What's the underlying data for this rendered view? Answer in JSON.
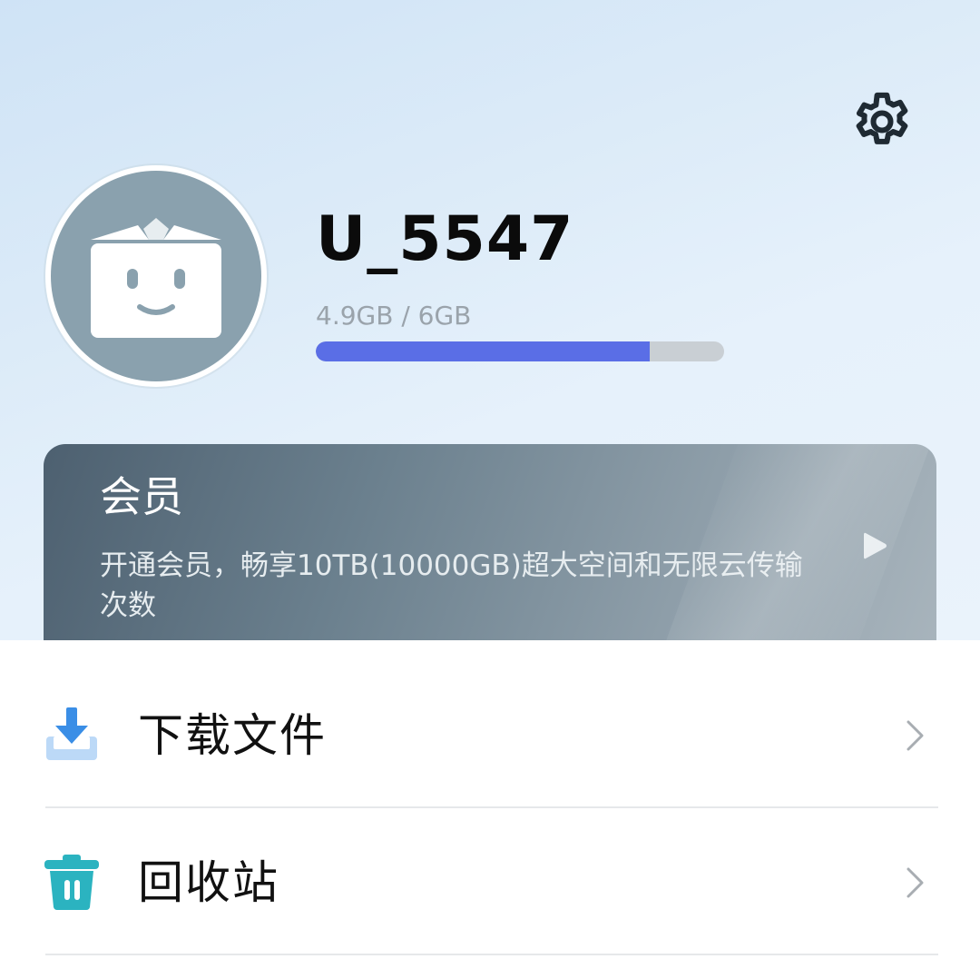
{
  "header": {
    "settings_icon": "gear-icon",
    "avatar_icon": "box-face-icon"
  },
  "profile": {
    "username": "U_5547",
    "storage_text": "4.9GB / 6GB",
    "storage_used_fraction": 0.817
  },
  "vip_card": {
    "title": "会员",
    "description": "开通会员，畅享10TB(10000GB)超大空间和无限云传输次数",
    "arrow_icon": "play-arrow-icon"
  },
  "menu": {
    "items": [
      {
        "label": "下载文件",
        "icon": "download-icon",
        "color": "#3a8ee6"
      },
      {
        "label": "回收站",
        "icon": "trash-icon",
        "color": "#2bb3c0"
      }
    ]
  },
  "colors": {
    "progress_fill": "#5a6ee6",
    "progress_track": "#c9cfd4",
    "avatar_bg": "#8aa1ae"
  }
}
